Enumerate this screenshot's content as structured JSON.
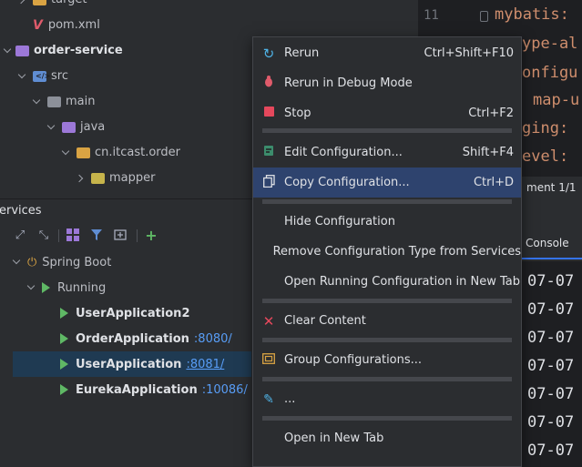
{
  "project_tree": {
    "items": [
      {
        "label": "target",
        "icon": "folder-icon"
      },
      {
        "label": "pom.xml",
        "icon": "maven-icon"
      },
      {
        "label": "order-service",
        "icon": "module-folder-icon"
      },
      {
        "label": "src",
        "icon": "source-folder-icon"
      },
      {
        "label": "main",
        "icon": "folder-icon"
      },
      {
        "label": "java",
        "icon": "source-root-folder-icon"
      },
      {
        "label": "cn.itcast.order",
        "icon": "package-icon"
      },
      {
        "label": "mapper",
        "icon": "package-icon"
      }
    ]
  },
  "editor": {
    "line_number": "11",
    "lines": [
      "mybatis:",
      "ype-al",
      "onfigu",
      "map-u",
      "ging:",
      "evel:"
    ]
  },
  "breadcrumb": {
    "text": "ment 1/1"
  },
  "services": {
    "title": "ervices",
    "toolbar_icons": [
      "expand-all-icon",
      "collapse-all-icon",
      "group-by-icon",
      "filter-icon",
      "new-tab-icon",
      "add-service-icon"
    ],
    "tree": {
      "spring_boot_label": "Spring Boot",
      "running_label": "Running",
      "apps": [
        {
          "name": "UserApplication2",
          "port": ""
        },
        {
          "name": "OrderApplication",
          "port": ":8080/"
        },
        {
          "name": "UserApplication",
          "port": ":8081/"
        },
        {
          "name": "EurekaApplication",
          "port": ":10086/"
        }
      ]
    }
  },
  "console": {
    "tab_label": "Console",
    "lines": [
      "07-07",
      "07-07",
      "07-07",
      "07-07",
      "07-07",
      "07-07",
      "07-07"
    ]
  },
  "context_menu": {
    "items": [
      {
        "label": "Rerun",
        "shortcut": "Ctrl+Shift+F10",
        "icon": "rerun-icon"
      },
      {
        "label": "Rerun in Debug Mode",
        "shortcut": "",
        "icon": "debug-icon"
      },
      {
        "label": "Stop",
        "shortcut": "Ctrl+F2",
        "icon": "stop-icon"
      },
      {
        "label": "Edit Configuration...",
        "shortcut": "Shift+F4",
        "icon": "edit-config-icon"
      },
      {
        "label": "Copy Configuration...",
        "shortcut": "Ctrl+D",
        "icon": "copy-icon"
      },
      {
        "label": "Hide Configuration",
        "shortcut": "",
        "icon": ""
      },
      {
        "label": "Remove Configuration Type from Services",
        "shortcut": "",
        "icon": ""
      },
      {
        "label": "Open Running Configuration in New Tab",
        "shortcut": "",
        "icon": ""
      },
      {
        "label": "Clear Content",
        "shortcut": "",
        "icon": "clear-icon"
      },
      {
        "label": "Group Configurations...",
        "shortcut": "",
        "icon": "group-icon"
      },
      {
        "label": "...",
        "shortcut": "",
        "icon": "pencil-icon"
      },
      {
        "label": "Open in New Tab",
        "shortcut": "",
        "icon": ""
      }
    ]
  },
  "colors": {
    "menu_highlight": "#2e436e",
    "selection": "#1f3a52",
    "run_green": "#5fb865",
    "link_blue": "#589df6",
    "yaml_key": "#cf8e6d"
  }
}
